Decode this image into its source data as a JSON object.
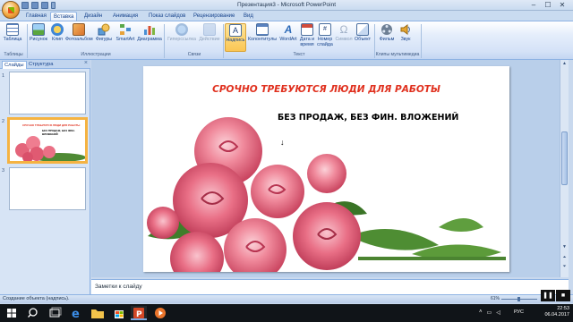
{
  "window": {
    "title": "Презентация3 - Microsoft PowerPoint",
    "min": "–",
    "max": "☐",
    "close": "✕"
  },
  "tabs": [
    {
      "label": "Главная"
    },
    {
      "label": "Вставка"
    },
    {
      "label": "Дизайн"
    },
    {
      "label": "Анимация"
    },
    {
      "label": "Показ слайдов"
    },
    {
      "label": "Рецензирование"
    },
    {
      "label": "Вид"
    }
  ],
  "ribbon": {
    "buttons": {
      "table": "Таблица",
      "picture": "Рисунок",
      "clip": "Клип",
      "album": "Фотоальбом",
      "shapes": "Фигуры",
      "smartart": "SmartArt",
      "chart": "Диаграмма",
      "hyperlink": "Гиперссылка",
      "action": "Действие",
      "textbox": "Надпись",
      "headerfooter": "Колонтитулы",
      "wordart": "WordArt",
      "datetime_1": "Дата и",
      "datetime_2": "время",
      "slidenum_1": "Номер",
      "slidenum_2": "слайда",
      "symbol": "Символ",
      "object": "Объект",
      "movie": "Фильм",
      "sound": "Звук"
    },
    "groups": {
      "tables": "Таблицы",
      "illustrations": "Иллюстрации",
      "links": "Связи",
      "text": "Текст",
      "media": "Клипы мультимедиа"
    }
  },
  "panel": {
    "tab_slides": "Слайды",
    "tab_outline": "Структура",
    "close": "×",
    "thumbs": [
      {
        "num": "1"
      },
      {
        "num": "2",
        "red": "СРОЧНО ТРЕБУЮТСЯ ЛЮДИ ДЛЯ РАБОТЫ",
        "black": "БЕЗ ПРОДАЖ, БЕЗ ФИН. ВЛОЖЕНИЙ"
      },
      {
        "num": "3"
      }
    ]
  },
  "slide": {
    "title": "СРОЧНО ТРЕБУЮТСЯ ЛЮДИ ДЛЯ РАБОТЫ",
    "subtitle": "БЕЗ ПРОДАЖ, БЕЗ ФИН. ВЛОЖЕНИЙ",
    "cursor": "↓",
    "title_color": "#e0301e"
  },
  "notes": {
    "placeholder": "Заметки к слайду"
  },
  "status": {
    "text": "Создание объекта (надпись).",
    "zoom": "61%"
  },
  "video": {
    "pause": "❚❚",
    "stop": "■"
  },
  "taskbar": {
    "lang": "РУС",
    "time": "22:53",
    "date": "06.04.2017"
  },
  "colors": {
    "ribbon_accent": "#15428b",
    "selection": "#f5b342"
  }
}
